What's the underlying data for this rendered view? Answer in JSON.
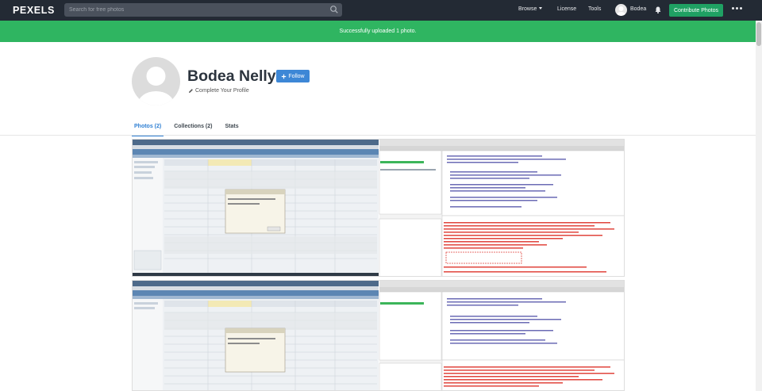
{
  "nav": {
    "logo": "PEXELS",
    "search_placeholder": "Search for free photos",
    "browse": "Browse",
    "license": "License",
    "tools": "Tools",
    "user": "Bodea",
    "contribute": "Contribute Photos"
  },
  "banner": {
    "message": "Successfully uploaded 1 photo."
  },
  "profile": {
    "name": "Bodea Nelly",
    "follow_label": "Follow",
    "complete_label": "Complete Your Profile"
  },
  "tabs": [
    {
      "label": "Photos (2)",
      "active": true
    },
    {
      "label": "Collections (2)",
      "active": false
    },
    {
      "label": "Stats",
      "active": false
    }
  ],
  "colors": {
    "nav_bg": "#232a34",
    "banner_green": "#2fb561",
    "contribute_green": "#1fa163",
    "follow_blue": "#3d87d6",
    "tab_active": "#2e7fd3"
  },
  "icons": [
    "search-icon",
    "bell-icon",
    "more-dots-icon",
    "pencil-icon",
    "plus-icon",
    "user-avatar-icon"
  ],
  "photos": [
    {
      "alt": "screenshot-1"
    },
    {
      "alt": "screenshot-2"
    }
  ]
}
